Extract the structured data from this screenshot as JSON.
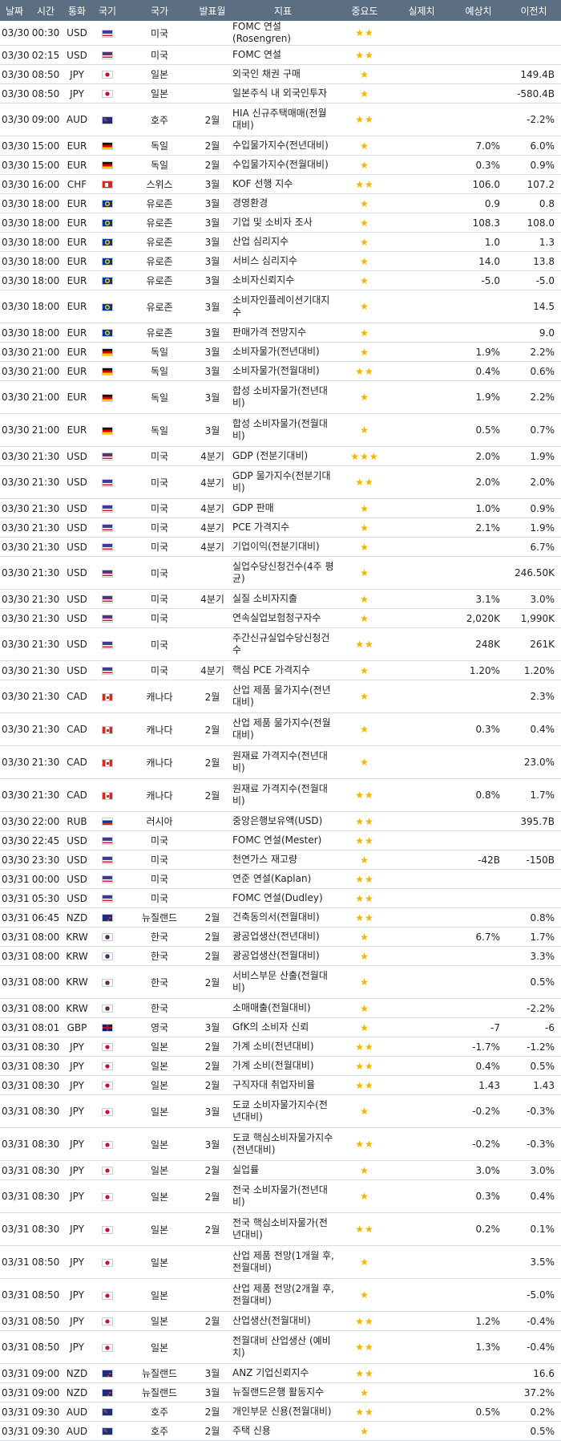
{
  "headers": [
    "날짜",
    "시간",
    "통화",
    "국기",
    "국가",
    "발표월",
    "지표",
    "중요도",
    "실제치",
    "예상치",
    "이전치"
  ],
  "rows": [
    [
      "03/30",
      "00:30",
      "USD",
      "US",
      "미국",
      "",
      "FOMC 연설(Rosengren)",
      2,
      "",
      "",
      ""
    ],
    [
      "03/30",
      "02:15",
      "USD",
      "US",
      "미국",
      "",
      "FOMC 연설",
      2,
      "",
      "",
      ""
    ],
    [
      "03/30",
      "08:50",
      "JPY",
      "JP",
      "일본",
      "",
      "외국인 채권 구매",
      1,
      "",
      "",
      "149.4B"
    ],
    [
      "03/30",
      "08:50",
      "JPY",
      "JP",
      "일본",
      "",
      "일본주식 내 외국인투자",
      1,
      "",
      "",
      "-580.4B"
    ],
    [
      "03/30",
      "09:00",
      "AUD",
      "AU",
      "호주",
      "2월",
      "HIA 신규주택매매(전월대비)",
      2,
      "",
      "",
      "-2.2%"
    ],
    [
      "03/30",
      "15:00",
      "EUR",
      "DE",
      "독일",
      "2월",
      "수입물가지수(전년대비)",
      1,
      "",
      "7.0%",
      "6.0%"
    ],
    [
      "03/30",
      "15:00",
      "EUR",
      "DE",
      "독일",
      "2월",
      "수입물가지수(전월대비)",
      1,
      "",
      "0.3%",
      "0.9%"
    ],
    [
      "03/30",
      "16:00",
      "CHF",
      "CH",
      "스위스",
      "3월",
      "KOF 선행 지수",
      2,
      "",
      "106.0",
      "107.2"
    ],
    [
      "03/30",
      "18:00",
      "EUR",
      "EU",
      "유로존",
      "3월",
      "경영환경",
      1,
      "",
      "0.9",
      "0.8"
    ],
    [
      "03/30",
      "18:00",
      "EUR",
      "EU",
      "유로존",
      "3월",
      "기업 및 소비자 조사",
      1,
      "",
      "108.3",
      "108.0"
    ],
    [
      "03/30",
      "18:00",
      "EUR",
      "EU",
      "유로존",
      "3월",
      "산업 심리지수",
      1,
      "",
      "1.0",
      "1.3"
    ],
    [
      "03/30",
      "18:00",
      "EUR",
      "EU",
      "유로존",
      "3월",
      "서비스 심리지수",
      1,
      "",
      "14.0",
      "13.8"
    ],
    [
      "03/30",
      "18:00",
      "EUR",
      "EU",
      "유로존",
      "3월",
      "소비자신뢰지수",
      1,
      "",
      "-5.0",
      "-5.0"
    ],
    [
      "03/30",
      "18:00",
      "EUR",
      "EU",
      "유로존",
      "3월",
      "소비자인플레이션기대지수",
      1,
      "",
      "",
      "14.5"
    ],
    [
      "03/30",
      "18:00",
      "EUR",
      "EU",
      "유로존",
      "3월",
      "판매가격 전망지수",
      1,
      "",
      "",
      "9.0"
    ],
    [
      "03/30",
      "21:00",
      "EUR",
      "DE",
      "독일",
      "3월",
      "소비자물가(전년대비)",
      1,
      "",
      "1.9%",
      "2.2%"
    ],
    [
      "03/30",
      "21:00",
      "EUR",
      "DE",
      "독일",
      "3월",
      "소비자물가(전월대비)",
      2,
      "",
      "0.4%",
      "0.6%"
    ],
    [
      "03/30",
      "21:00",
      "EUR",
      "DE",
      "독일",
      "3월",
      "합성 소비자물가(전년대비)",
      1,
      "",
      "1.9%",
      "2.2%"
    ],
    [
      "03/30",
      "21:00",
      "EUR",
      "DE",
      "독일",
      "3월",
      "합성 소비자물가(전월대비)",
      1,
      "",
      "0.5%",
      "0.7%"
    ],
    [
      "03/30",
      "21:30",
      "USD",
      "US",
      "미국",
      "4분기",
      "GDP (전분기대비)",
      3,
      "",
      "2.0%",
      "1.9%"
    ],
    [
      "03/30",
      "21:30",
      "USD",
      "US",
      "미국",
      "4분기",
      "GDP 물가지수(전분기대비)",
      2,
      "",
      "2.0%",
      "2.0%"
    ],
    [
      "03/30",
      "21:30",
      "USD",
      "US",
      "미국",
      "4분기",
      "GDP 판매",
      1,
      "",
      "1.0%",
      "0.9%"
    ],
    [
      "03/30",
      "21:30",
      "USD",
      "US",
      "미국",
      "4분기",
      "PCE 가격지수",
      1,
      "",
      "2.1%",
      "1.9%"
    ],
    [
      "03/30",
      "21:30",
      "USD",
      "US",
      "미국",
      "4분기",
      "기업이익(전분기대비)",
      1,
      "",
      "",
      "6.7%"
    ],
    [
      "03/30",
      "21:30",
      "USD",
      "US",
      "미국",
      "",
      "실업수당신청건수(4주 평균)",
      1,
      "",
      "",
      "246.50K"
    ],
    [
      "03/30",
      "21:30",
      "USD",
      "US",
      "미국",
      "4분기",
      "실질 소비자지출",
      1,
      "",
      "3.1%",
      "3.0%"
    ],
    [
      "03/30",
      "21:30",
      "USD",
      "US",
      "미국",
      "",
      "연속실업보험청구자수",
      1,
      "",
      "2,020K",
      "1,990K"
    ],
    [
      "03/30",
      "21:30",
      "USD",
      "US",
      "미국",
      "",
      "주간신규실업수당신청건수",
      2,
      "",
      "248K",
      "261K"
    ],
    [
      "03/30",
      "21:30",
      "USD",
      "US",
      "미국",
      "4분기",
      "핵심 PCE 가격지수",
      1,
      "",
      "1.20%",
      "1.20%"
    ],
    [
      "03/30",
      "21:30",
      "CAD",
      "CA",
      "캐나다",
      "2월",
      "산업 제품 물가지수(전년대비)",
      1,
      "",
      "",
      "2.3%"
    ],
    [
      "03/30",
      "21:30",
      "CAD",
      "CA",
      "캐나다",
      "2월",
      "산업 제품 물가지수(전월대비)",
      1,
      "",
      "0.3%",
      "0.4%"
    ],
    [
      "03/30",
      "21:30",
      "CAD",
      "CA",
      "캐나다",
      "2월",
      "원재료 가격지수(전년대비)",
      1,
      "",
      "",
      "23.0%"
    ],
    [
      "03/30",
      "21:30",
      "CAD",
      "CA",
      "캐나다",
      "2월",
      "원재료 가격지수(전월대비)",
      2,
      "",
      "0.8%",
      "1.7%"
    ],
    [
      "03/30",
      "22:00",
      "RUB",
      "RU",
      "러시아",
      "",
      "중앙은행보유액(USD)",
      2,
      "",
      "",
      "395.7B"
    ],
    [
      "03/30",
      "22:45",
      "USD",
      "US",
      "미국",
      "",
      "FOMC 연설(Mester)",
      2,
      "",
      "",
      ""
    ],
    [
      "03/30",
      "23:30",
      "USD",
      "US",
      "미국",
      "",
      "천연가스 재고량",
      1,
      "",
      "-42B",
      "-150B"
    ],
    [
      "03/31",
      "00:00",
      "USD",
      "US",
      "미국",
      "",
      "연준 연설(Kaplan)",
      2,
      "",
      "",
      ""
    ],
    [
      "03/31",
      "05:30",
      "USD",
      "US",
      "미국",
      "",
      "FOMC 연설(Dudley)",
      2,
      "",
      "",
      ""
    ],
    [
      "03/31",
      "06:45",
      "NZD",
      "NZ",
      "뉴질랜드",
      "2월",
      "건축동의서(전월대비)",
      2,
      "",
      "",
      "0.8%"
    ],
    [
      "03/31",
      "08:00",
      "KRW",
      "KR",
      "한국",
      "2월",
      "광공업생산(전년대비)",
      1,
      "",
      "6.7%",
      "1.7%"
    ],
    [
      "03/31",
      "08:00",
      "KRW",
      "KR",
      "한국",
      "2월",
      "광공업생산(전월대비)",
      1,
      "",
      "",
      "3.3%"
    ],
    [
      "03/31",
      "08:00",
      "KRW",
      "KR",
      "한국",
      "2월",
      "서비스부문 산출(전월대비)",
      1,
      "",
      "",
      "0.5%"
    ],
    [
      "03/31",
      "08:00",
      "KRW",
      "KR",
      "한국",
      "",
      "소매매출(전월대비)",
      1,
      "",
      "",
      "-2.2%"
    ],
    [
      "03/31",
      "08:01",
      "GBP",
      "GB",
      "영국",
      "3월",
      "GfK의 소비자 신뢰",
      1,
      "",
      "-7",
      "-6"
    ],
    [
      "03/31",
      "08:30",
      "JPY",
      "JP",
      "일본",
      "2월",
      "가계 소비(전년대비)",
      2,
      "",
      "-1.7%",
      "-1.2%"
    ],
    [
      "03/31",
      "08:30",
      "JPY",
      "JP",
      "일본",
      "2월",
      "가계 소비(전월대비)",
      2,
      "",
      "0.4%",
      "0.5%"
    ],
    [
      "03/31",
      "08:30",
      "JPY",
      "JP",
      "일본",
      "2월",
      "구직자대 취업자비율",
      2,
      "",
      "1.43",
      "1.43"
    ],
    [
      "03/31",
      "08:30",
      "JPY",
      "JP",
      "일본",
      "3월",
      "도쿄 소비자물가지수(전년대비)",
      1,
      "",
      "-0.2%",
      "-0.3%"
    ],
    [
      "03/31",
      "08:30",
      "JPY",
      "JP",
      "일본",
      "3월",
      "도쿄 핵심소비자물가지수(전년대비)",
      2,
      "",
      "-0.2%",
      "-0.3%"
    ],
    [
      "03/31",
      "08:30",
      "JPY",
      "JP",
      "일본",
      "2월",
      "실업률",
      1,
      "",
      "3.0%",
      "3.0%"
    ],
    [
      "03/31",
      "08:30",
      "JPY",
      "JP",
      "일본",
      "2월",
      "전국 소비자물가(전년대비)",
      1,
      "",
      "0.3%",
      "0.4%"
    ],
    [
      "03/31",
      "08:30",
      "JPY",
      "JP",
      "일본",
      "2월",
      "전국 핵심소비자물가(전년대비)",
      2,
      "",
      "0.2%",
      "0.1%"
    ],
    [
      "03/31",
      "08:50",
      "JPY",
      "JP",
      "일본",
      "",
      "산업 제품 전망(1개월 후, 전월대비)",
      1,
      "",
      "",
      "3.5%"
    ],
    [
      "03/31",
      "08:50",
      "JPY",
      "JP",
      "일본",
      "",
      "산업 제품 전망(2개월 후, 전월대비)",
      1,
      "",
      "",
      "-5.0%"
    ],
    [
      "03/31",
      "08:50",
      "JPY",
      "JP",
      "일본",
      "2월",
      "산업생산(전월대비)",
      2,
      "",
      "1.2%",
      "-0.4%"
    ],
    [
      "03/31",
      "08:50",
      "JPY",
      "JP",
      "일본",
      "",
      "전월대비 산업생산 (예비치)",
      2,
      "",
      "1.3%",
      "-0.4%"
    ],
    [
      "03/31",
      "09:00",
      "NZD",
      "NZ",
      "뉴질랜드",
      "3월",
      "ANZ 기업신뢰지수",
      2,
      "",
      "",
      "16.6"
    ],
    [
      "03/31",
      "09:00",
      "NZD",
      "NZ",
      "뉴질랜드",
      "3월",
      "뉴질랜드은행 활동지수",
      1,
      "",
      "",
      "37.2%"
    ],
    [
      "03/31",
      "09:30",
      "AUD",
      "AU",
      "호주",
      "2월",
      "개인부문 신용(전월대비)",
      2,
      "",
      "0.5%",
      "0.2%"
    ],
    [
      "03/31",
      "09:30",
      "AUD",
      "AU",
      "호주",
      "2월",
      "주택 신용",
      1,
      "",
      "",
      "0.5%"
    ]
  ],
  "tall_rows": [
    4,
    13,
    17,
    18,
    20,
    24,
    27,
    29,
    30,
    31,
    32,
    41,
    47,
    48,
    50,
    51,
    52,
    53,
    55
  ],
  "star_color": "#f5b400",
  "header_color": "#5c6e82"
}
